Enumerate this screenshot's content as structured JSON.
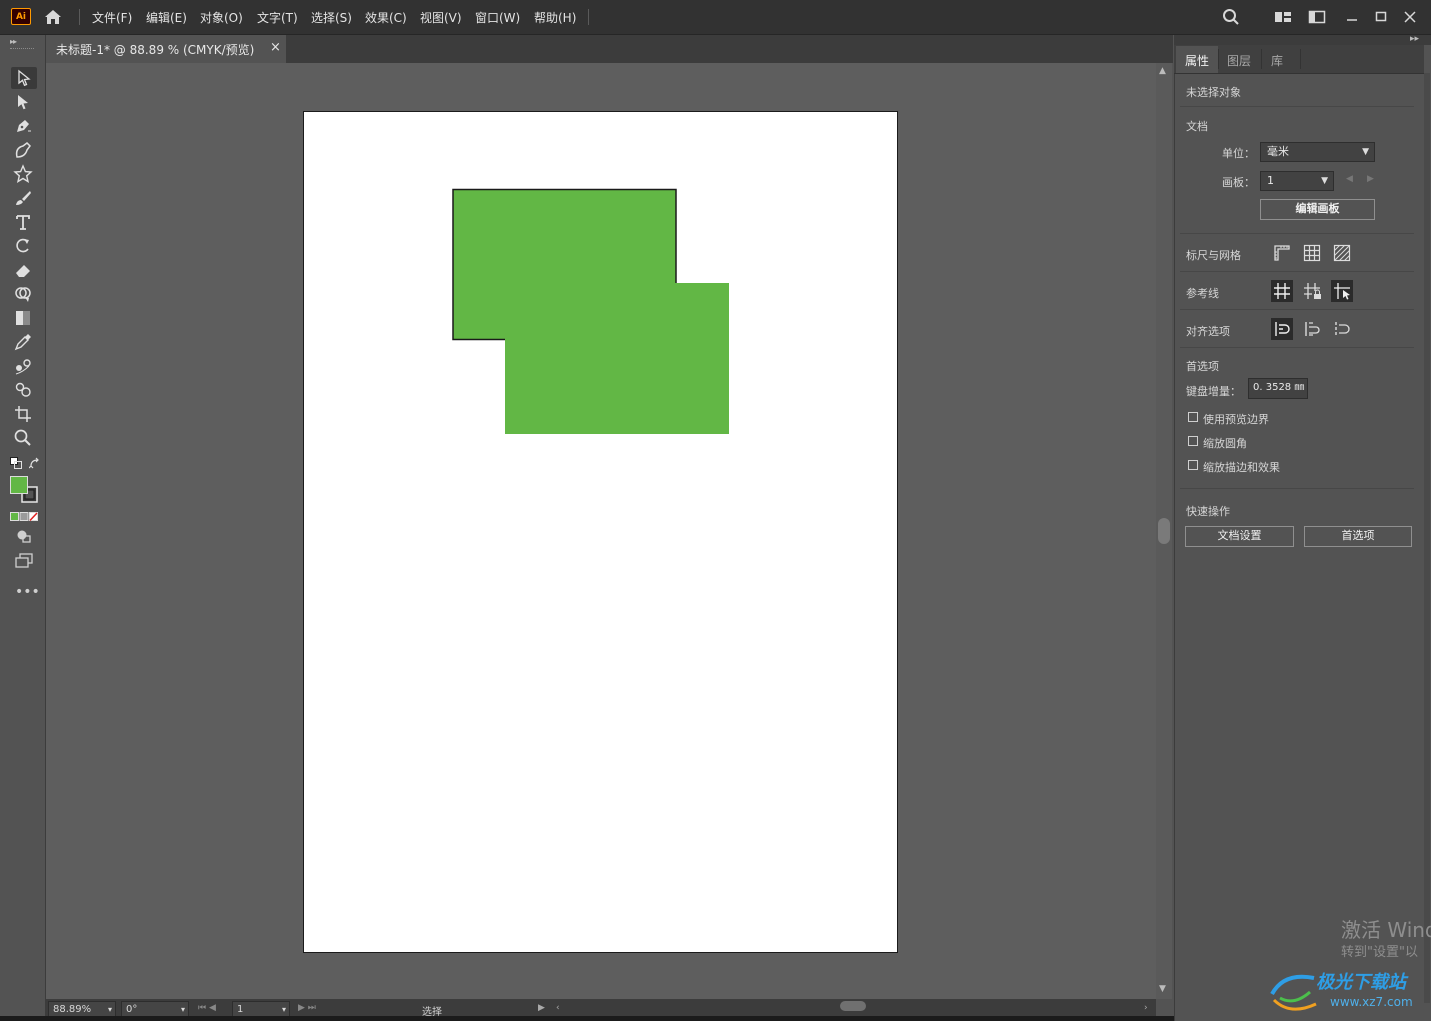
{
  "app": {
    "logo": "Ai"
  },
  "menu": [
    {
      "label": "文件(F)"
    },
    {
      "label": "编辑(E)"
    },
    {
      "label": "对象(O)"
    },
    {
      "label": "文字(T)"
    },
    {
      "label": "选择(S)"
    },
    {
      "label": "效果(C)"
    },
    {
      "label": "视图(V)"
    },
    {
      "label": "窗口(W)"
    },
    {
      "label": "帮助(H)"
    }
  ],
  "document": {
    "tab_title": "未标题-1* @ 88.89 % (CMYK/预览)",
    "close_glyph": "×"
  },
  "colors": {
    "fill": "#62b745",
    "stroke": "#1a1a1a",
    "artboard": "#ffffff",
    "ui_bg": "#535353"
  },
  "tools": [
    {
      "name": "selection-tool"
    },
    {
      "name": "direct-selection-tool"
    },
    {
      "name": "pen-tool"
    },
    {
      "name": "curvature-tool"
    },
    {
      "name": "star-tool"
    },
    {
      "name": "paintbrush-tool"
    },
    {
      "name": "type-tool"
    },
    {
      "name": "rotate-tool"
    },
    {
      "name": "eraser-tool"
    },
    {
      "name": "shape-builder-tool"
    },
    {
      "name": "gradient-tool"
    },
    {
      "name": "eyedropper-tool"
    },
    {
      "name": "blend-tool"
    },
    {
      "name": "symbol-sprayer-tool"
    },
    {
      "name": "artboard-tool"
    },
    {
      "name": "zoom-tool"
    }
  ],
  "status": {
    "zoom": "88.89%",
    "rotation": "0°",
    "artboard": "1",
    "mode": "选择"
  },
  "panel": {
    "tabs": [
      {
        "label": "属性"
      },
      {
        "label": "图层"
      },
      {
        "label": "库"
      }
    ],
    "no_selection": "未选择对象",
    "document_section": "文档",
    "units_label": "单位：",
    "units_value": "毫米",
    "artboard_label": "画板：",
    "artboard_value": "1",
    "edit_artboard_button": "编辑画板",
    "rulers_grids": "标尺与网格",
    "guides": "参考线",
    "align_options": "对齐选项",
    "preferences_section": "首选项",
    "keyboard_increment_label": "键盘增量：",
    "keyboard_increment_value": "0. 3528 ㎜",
    "checkboxes": [
      {
        "label": "使用预览边界",
        "checked": false
      },
      {
        "label": "缩放圆角",
        "checked": false
      },
      {
        "label": "缩放描边和效果",
        "checked": false
      }
    ],
    "quick_actions": "快速操作",
    "doc_setup_button": "文档设置",
    "preferences_button": "首选项"
  },
  "watermark": {
    "activate_line1": "激活 Wind",
    "activate_line2": "转到\"设置\"以",
    "site_name": "极光下载站",
    "site_url": "www.xz7.com"
  }
}
